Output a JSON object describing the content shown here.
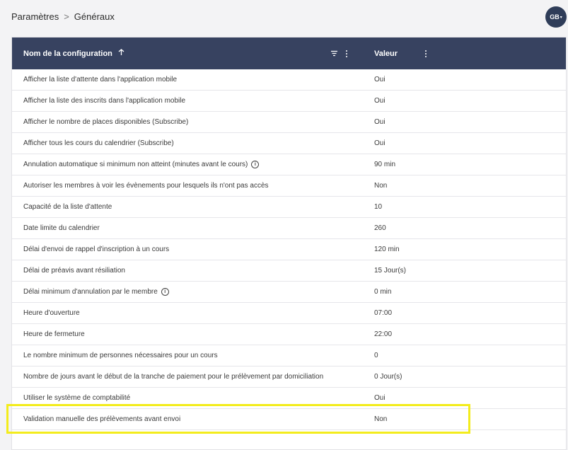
{
  "breadcrumb": {
    "parent": "Paramètres",
    "separator": ">",
    "current": "Généraux"
  },
  "user": {
    "initials": "GB"
  },
  "table": {
    "columns": {
      "name": "Nom de la configuration",
      "value": "Valeur"
    },
    "rows": [
      {
        "name": "Afficher la liste d'attente dans l'application mobile",
        "value": "Oui"
      },
      {
        "name": "Afficher la liste des inscrits dans l'application mobile",
        "value": "Oui"
      },
      {
        "name": "Afficher le nombre de places disponibles (Subscribe)",
        "value": "Oui"
      },
      {
        "name": "Afficher tous les cours du calendrier (Subscribe)",
        "value": "Oui"
      },
      {
        "name": "Annulation automatique si minimum non atteint (minutes avant le cours)",
        "value": "90 min",
        "info": true
      },
      {
        "name": "Autoriser les membres à voir les évènements pour lesquels ils n'ont pas accès",
        "value": "Non"
      },
      {
        "name": "Capacité de la liste d'attente",
        "value": "10"
      },
      {
        "name": "Date limite du calendrier",
        "value": "260"
      },
      {
        "name": "Délai d'envoi de rappel d'inscription à un cours",
        "value": "120 min"
      },
      {
        "name": "Délai de préavis avant résiliation",
        "value": "15 Jour(s)"
      },
      {
        "name": "Délai minimum d'annulation par le membre",
        "value": "0 min",
        "info": true
      },
      {
        "name": "Heure d'ouverture",
        "value": "07:00"
      },
      {
        "name": "Heure de fermeture",
        "value": "22:00"
      },
      {
        "name": "Le nombre minimum de personnes nécessaires pour un cours",
        "value": "0"
      },
      {
        "name": "Nombre de jours avant le début de la tranche de paiement pour le prélèvement par domiciliation",
        "value": "0 Jour(s)"
      },
      {
        "name": "Utiliser le système de comptabilité",
        "value": "Oui"
      },
      {
        "name": "Validation manuelle des prélèvements avant envoi",
        "value": "Non"
      }
    ]
  },
  "colors": {
    "header_bg": "#374260",
    "avatar_bg": "#2f3d59",
    "highlight": "#f3ec1c"
  }
}
